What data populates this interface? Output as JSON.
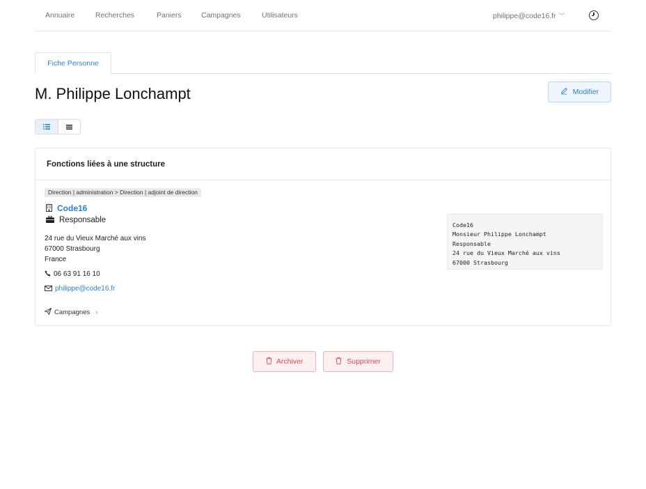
{
  "nav": {
    "items": [
      "Annuaire",
      "Recherches",
      "Paniers",
      "Campagnes",
      "Utilisateurs"
    ],
    "user": "philippe@code16.fr"
  },
  "tabs": [
    {
      "label": "Fiche Personne"
    }
  ],
  "page": {
    "title": "M. Philippe Lonchampt",
    "edit_label": "Modifier"
  },
  "section": {
    "title": "Fonctions liées à une structure",
    "breadcrumb": "Direction | administration  >  Direction | adjoint de direction",
    "organization": "Code16",
    "role": "Responsable",
    "address_line1": "24 rue du Vieux Marché aux vins",
    "address_line2": "67000 Strasbourg",
    "address_line3": "France",
    "phone": "06 63 91 16 10",
    "email": "philippe@code16.fr",
    "campaigns_label": "Campagnes",
    "mailing_label": "Code16\nMonsieur Philippe Lonchampt\nResponsable\n24 rue du Vieux Marché aux vins\n67000 Strasbourg"
  },
  "actions": {
    "archive_label": "Archiver",
    "delete_label": "Supprimer"
  },
  "colors": {
    "accent": "#2d7fd6",
    "danger": "#e0454d"
  }
}
